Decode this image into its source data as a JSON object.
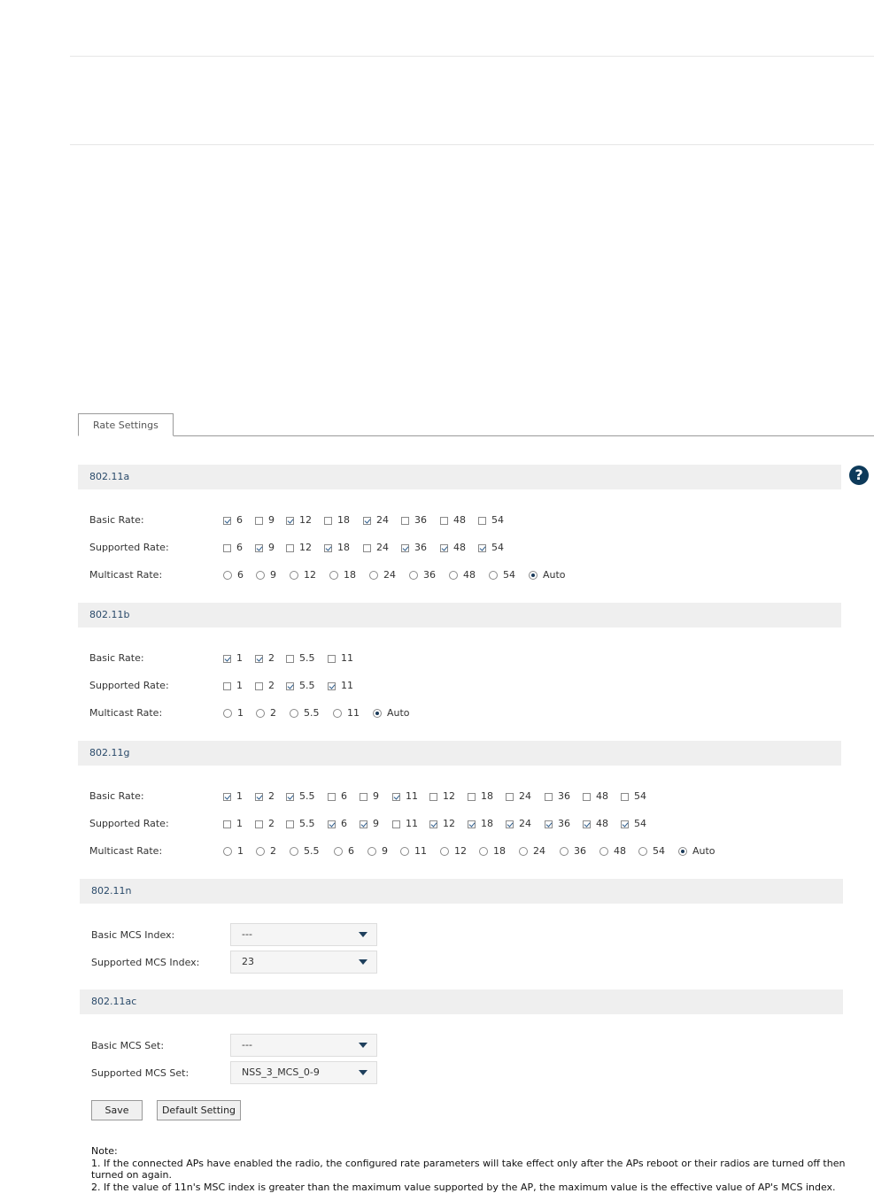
{
  "tab": {
    "label": "Rate Settings"
  },
  "sections": {
    "a": {
      "title": "802.11a",
      "basic_label": "Basic Rate:",
      "supported_label": "Supported Rate:",
      "multicast_label": "Multicast Rate:",
      "basic": [
        {
          "v": "6",
          "on": true
        },
        {
          "v": "9",
          "on": false
        },
        {
          "v": "12",
          "on": true
        },
        {
          "v": "18",
          "on": false
        },
        {
          "v": "24",
          "on": true
        },
        {
          "v": "36",
          "on": false
        },
        {
          "v": "48",
          "on": false
        },
        {
          "v": "54",
          "on": false
        }
      ],
      "supported": [
        {
          "v": "6",
          "on": false
        },
        {
          "v": "9",
          "on": true
        },
        {
          "v": "12",
          "on": false
        },
        {
          "v": "18",
          "on": true
        },
        {
          "v": "24",
          "on": false
        },
        {
          "v": "36",
          "on": true
        },
        {
          "v": "48",
          "on": true
        },
        {
          "v": "54",
          "on": true
        }
      ],
      "multicast": [
        {
          "v": "6",
          "on": false
        },
        {
          "v": "9",
          "on": false
        },
        {
          "v": "12",
          "on": false
        },
        {
          "v": "18",
          "on": false
        },
        {
          "v": "24",
          "on": false
        },
        {
          "v": "36",
          "on": false
        },
        {
          "v": "48",
          "on": false
        },
        {
          "v": "54",
          "on": false
        },
        {
          "v": "Auto",
          "on": true
        }
      ]
    },
    "b": {
      "title": "802.11b",
      "basic_label": "Basic Rate:",
      "supported_label": "Supported Rate:",
      "multicast_label": "Multicast Rate:",
      "basic": [
        {
          "v": "1",
          "on": true
        },
        {
          "v": "2",
          "on": true
        },
        {
          "v": "5.5",
          "on": false
        },
        {
          "v": "11",
          "on": false
        }
      ],
      "supported": [
        {
          "v": "1",
          "on": false
        },
        {
          "v": "2",
          "on": false
        },
        {
          "v": "5.5",
          "on": true
        },
        {
          "v": "11",
          "on": true
        }
      ],
      "multicast": [
        {
          "v": "1",
          "on": false
        },
        {
          "v": "2",
          "on": false
        },
        {
          "v": "5.5",
          "on": false
        },
        {
          "v": "11",
          "on": false
        },
        {
          "v": "Auto",
          "on": true
        }
      ]
    },
    "g": {
      "title": "802.11g",
      "basic_label": "Basic Rate:",
      "supported_label": "Supported Rate:",
      "multicast_label": "Multicast Rate:",
      "basic": [
        {
          "v": "1",
          "on": true
        },
        {
          "v": "2",
          "on": true
        },
        {
          "v": "5.5",
          "on": true
        },
        {
          "v": "6",
          "on": false
        },
        {
          "v": "9",
          "on": false
        },
        {
          "v": "11",
          "on": true
        },
        {
          "v": "12",
          "on": false
        },
        {
          "v": "18",
          "on": false
        },
        {
          "v": "24",
          "on": false
        },
        {
          "v": "36",
          "on": false
        },
        {
          "v": "48",
          "on": false
        },
        {
          "v": "54",
          "on": false
        }
      ],
      "supported": [
        {
          "v": "1",
          "on": false
        },
        {
          "v": "2",
          "on": false
        },
        {
          "v": "5.5",
          "on": false
        },
        {
          "v": "6",
          "on": true
        },
        {
          "v": "9",
          "on": true
        },
        {
          "v": "11",
          "on": false
        },
        {
          "v": "12",
          "on": true
        },
        {
          "v": "18",
          "on": true
        },
        {
          "v": "24",
          "on": true
        },
        {
          "v": "36",
          "on": true
        },
        {
          "v": "48",
          "on": true
        },
        {
          "v": "54",
          "on": true
        }
      ],
      "multicast": [
        {
          "v": "1",
          "on": false
        },
        {
          "v": "2",
          "on": false
        },
        {
          "v": "5.5",
          "on": false
        },
        {
          "v": "6",
          "on": false
        },
        {
          "v": "9",
          "on": false
        },
        {
          "v": "11",
          "on": false
        },
        {
          "v": "12",
          "on": false
        },
        {
          "v": "18",
          "on": false
        },
        {
          "v": "24",
          "on": false
        },
        {
          "v": "36",
          "on": false
        },
        {
          "v": "48",
          "on": false
        },
        {
          "v": "54",
          "on": false
        },
        {
          "v": "Auto",
          "on": true
        }
      ]
    },
    "n": {
      "title": "802.11n",
      "basic_mcs_label": "Basic MCS Index:",
      "basic_mcs_value": "---",
      "supported_mcs_label": "Supported MCS Index:",
      "supported_mcs_value": "23"
    },
    "ac": {
      "title": "802.11ac",
      "basic_mcs_label": "Basic MCS Set:",
      "basic_mcs_value": "---",
      "supported_mcs_label": "Supported MCS Set:",
      "supported_mcs_value": "NSS_3_MCS_0-9"
    }
  },
  "buttons": {
    "save": "Save",
    "default": "Default Setting"
  },
  "note": {
    "heading": "Note:",
    "line1": "1. If the connected APs have enabled the radio, the configured rate parameters will take effect only after the APs reboot or their radios are turned off then turned on again.",
    "line2": "2. If the value of 11n's MSC index is greater than the maximum value supported by the AP, the maximum value is the effective value of AP's MCS index."
  },
  "help": {
    "glyph": "?"
  }
}
